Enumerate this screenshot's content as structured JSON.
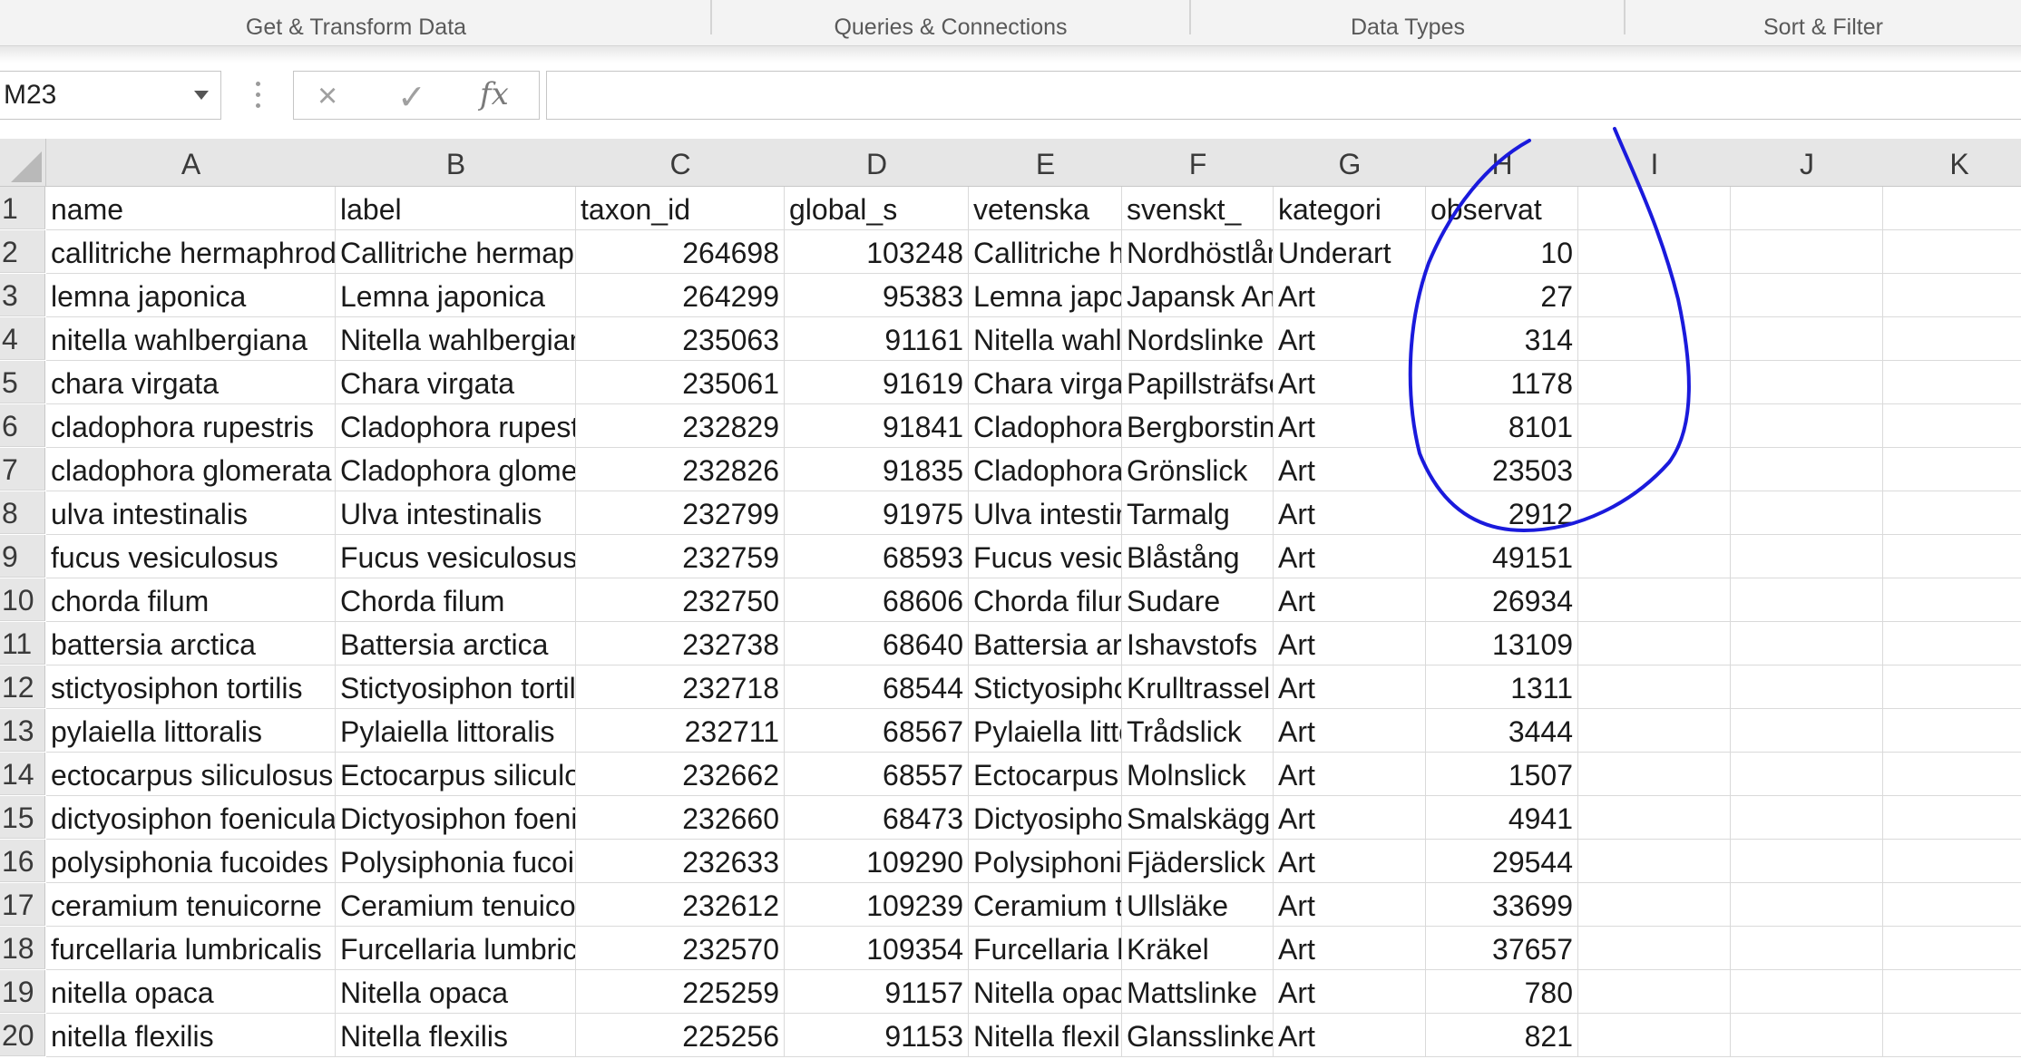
{
  "ribbon": {
    "groups": [
      "Get & Transform Data",
      "Queries & Connections",
      "Data Types",
      "Sort & Filter"
    ]
  },
  "formula_bar": {
    "name_box": "M23",
    "cancel_icon": "×",
    "enter_icon": "✓",
    "fx_label": "fx",
    "formula": ""
  },
  "columns": [
    "A",
    "B",
    "C",
    "D",
    "E",
    "F",
    "G",
    "H",
    "I",
    "J",
    "K"
  ],
  "rows": [
    [
      "name",
      "label",
      "taxon_id",
      "global_s",
      "vetenska",
      "svenskt_",
      "kategori",
      "observat"
    ],
    [
      "callitriche hermaphroditica",
      "Callitriche hermaphroditica",
      "264698",
      "103248",
      "Callitriche hermaphroditica",
      "Nordhöstlånke",
      "Underart",
      "10"
    ],
    [
      "lemna japonica",
      "Lemna japonica",
      "264299",
      "95383",
      "Lemna japonica",
      "Japansk Andmat",
      "Art",
      "27"
    ],
    [
      "nitella wahlbergiana",
      "Nitella wahlbergiana",
      "235063",
      "91161",
      "Nitella wahlbergiana",
      "Nordslinke",
      "Art",
      "314"
    ],
    [
      "chara virgata",
      "Chara virgata",
      "235061",
      "91619",
      "Chara virgata",
      "Papillsträfse",
      "Art",
      "1178"
    ],
    [
      "cladophora rupestris",
      "Cladophora rupestris",
      "232829",
      "91841",
      "Cladophora rupestris",
      "Bergborsting",
      "Art",
      "8101"
    ],
    [
      "cladophora glomerata",
      "Cladophora glomerata",
      "232826",
      "91835",
      "Cladophora glomerata",
      "Grönslick",
      "Art",
      "23503"
    ],
    [
      "ulva intestinalis",
      "Ulva intestinalis",
      "232799",
      "91975",
      "Ulva intestinalis",
      "Tarmalg",
      "Art",
      "2912"
    ],
    [
      "fucus vesiculosus",
      "Fucus vesiculosus",
      "232759",
      "68593",
      "Fucus vesiculosus",
      "Blåstång",
      "Art",
      "49151"
    ],
    [
      "chorda filum",
      "Chorda filum",
      "232750",
      "68606",
      "Chorda filum",
      "Sudare",
      "Art",
      "26934"
    ],
    [
      "battersia arctica",
      "Battersia arctica",
      "232738",
      "68640",
      "Battersia arctica",
      "Ishavstofs",
      "Art",
      "13109"
    ],
    [
      "stictyosiphon tortilis",
      "Stictyosiphon tortilis",
      "232718",
      "68544",
      "Stictyosiphon tortilis",
      "Krulltrassel",
      "Art",
      "1311"
    ],
    [
      "pylaiella littoralis",
      "Pylaiella littoralis",
      "232711",
      "68567",
      "Pylaiella littoralis",
      "Trådslick",
      "Art",
      "3444"
    ],
    [
      "ectocarpus siliculosus",
      "Ectocarpus siliculosus",
      "232662",
      "68557",
      "Ectocarpus siliculosus",
      "Molnslick",
      "Art",
      "1507"
    ],
    [
      "dictyosiphon foeniculaceus",
      "Dictyosiphon foeniculaceus",
      "232660",
      "68473",
      "Dictyosiphon foeniculaceus",
      "Smalskägg",
      "Art",
      "4941"
    ],
    [
      "polysiphonia fucoides",
      "Polysiphonia fucoides",
      "232633",
      "109290",
      "Polysiphonia fucoides",
      "Fjäderslick",
      "Art",
      "29544"
    ],
    [
      "ceramium tenuicorne",
      "Ceramium tenuicorne",
      "232612",
      "109239",
      "Ceramium tenuicorne",
      "Ullsläke",
      "Art",
      "33699"
    ],
    [
      "furcellaria lumbricalis",
      "Furcellaria lumbricalis",
      "232570",
      "109354",
      "Furcellaria lumbricalis",
      "Kräkel",
      "Art",
      "37657"
    ],
    [
      "nitella opaca",
      "Nitella opaca",
      "225259",
      "91157",
      "Nitella opaca",
      "Mattslinke",
      "Art",
      "780"
    ],
    [
      "nitella flexilis",
      "Nitella flexilis",
      "225256",
      "91153",
      "Nitella flexilis",
      "Glansslinke",
      "Art",
      "821"
    ]
  ],
  "annotation": {
    "color": "#1a1adc"
  }
}
